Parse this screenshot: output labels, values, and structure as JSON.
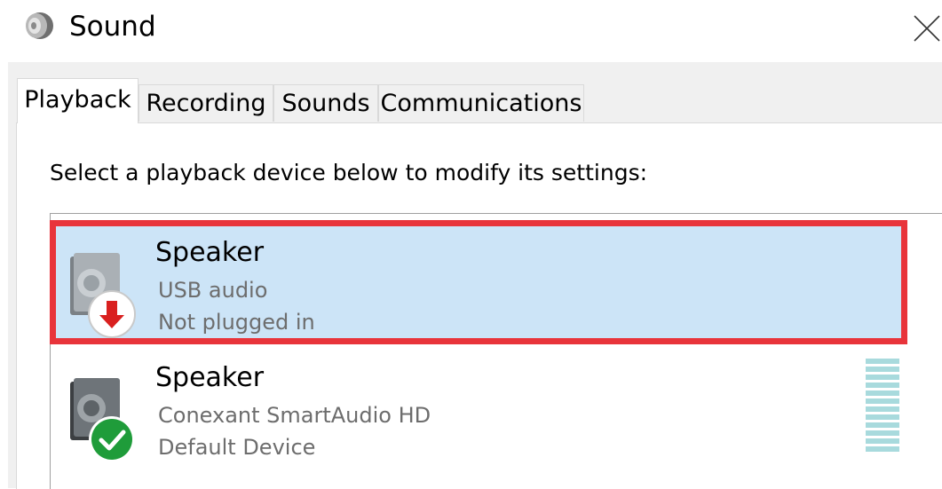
{
  "window": {
    "title": "Sound",
    "icon": "speaker-icon",
    "close_icon": "close-icon"
  },
  "tabs": [
    {
      "label": "Playback",
      "active": true
    },
    {
      "label": "Recording",
      "active": false
    },
    {
      "label": "Sounds",
      "active": false
    },
    {
      "label": "Communications",
      "active": false
    }
  ],
  "playback": {
    "instructions": "Select a playback device below to modify its settings:",
    "devices": [
      {
        "name": "Speaker",
        "description": "USB audio",
        "status": "Not plugged in",
        "status_icon": "unplugged-arrow-icon",
        "selected": true
      },
      {
        "name": "Speaker",
        "description": "Conexant SmartAudio HD",
        "status": "Default Device",
        "status_icon": "default-check-icon",
        "selected": false
      }
    ]
  },
  "colors": {
    "selection_background": "#cce4f7",
    "highlight_outline": "#e8343b",
    "unplugged_red": "#d9201f",
    "default_green": "#1f9c3a",
    "level_meter": "#a8dadd"
  }
}
